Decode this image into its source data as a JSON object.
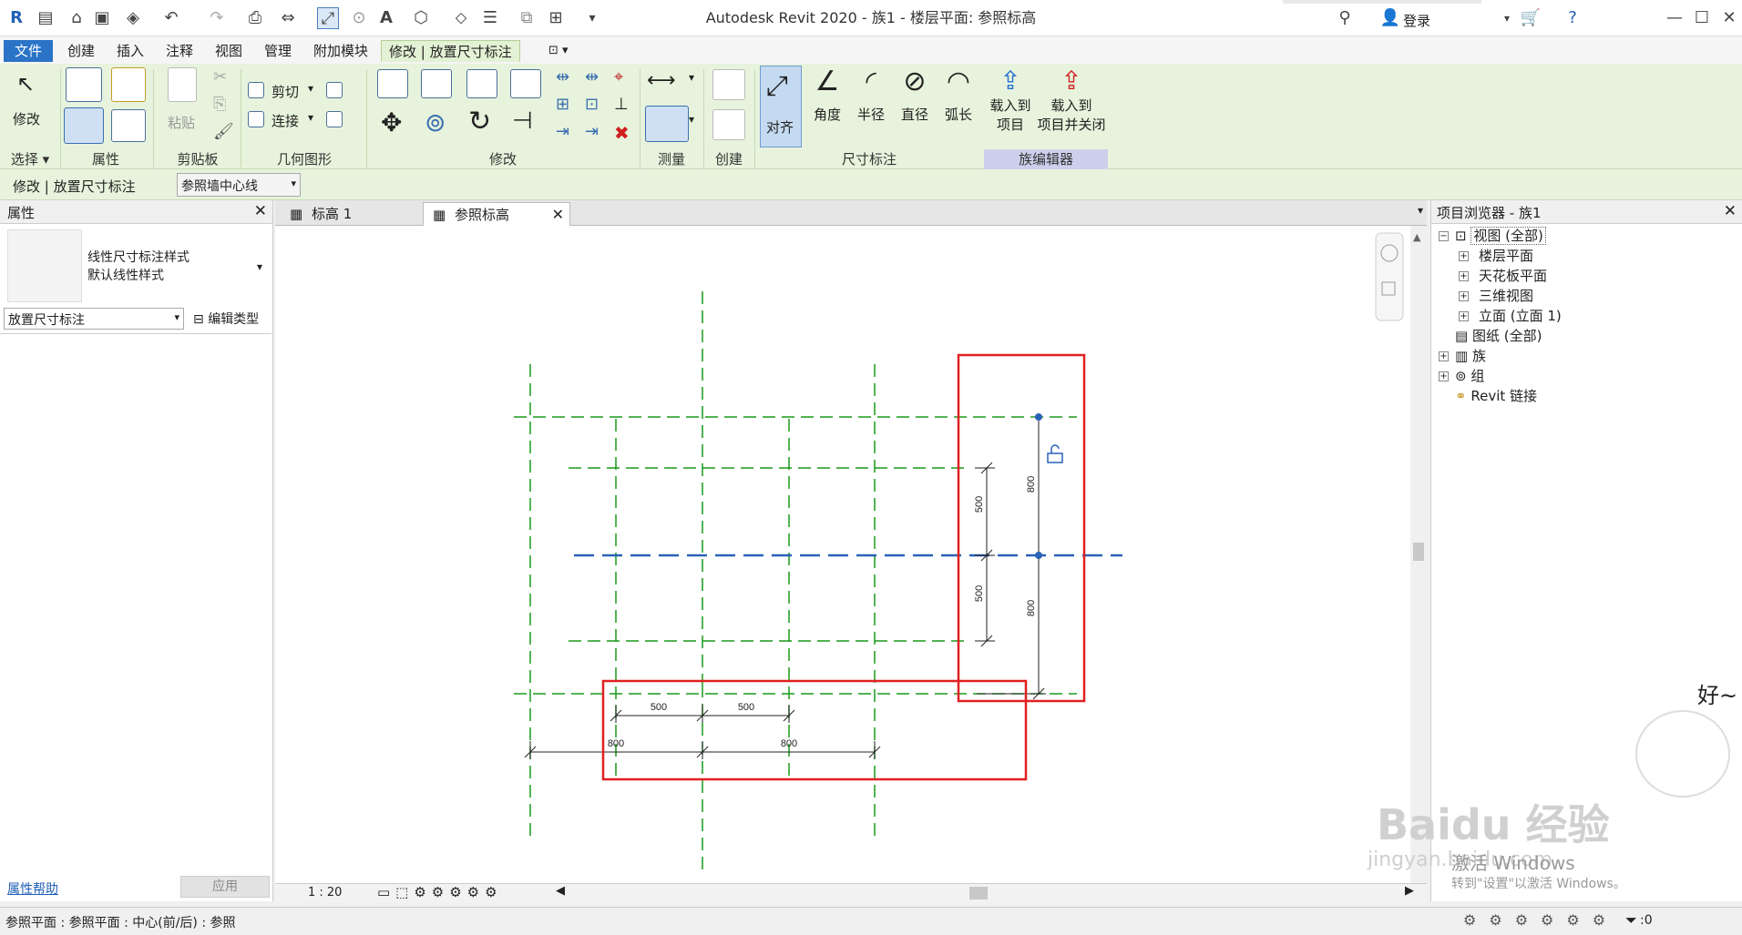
{
  "titlebar": {
    "title": "Autodesk Revit 2020 - 族1 - 楼层平面: 参照标高",
    "login": "登录"
  },
  "ribbon_tabs": {
    "file": "文件",
    "create": "创建",
    "insert": "插入",
    "annotate": "注释",
    "view": "视图",
    "manage": "管理",
    "addins": "附加模块",
    "active": "修改 | 放置尺寸标注"
  },
  "ribbon": {
    "modify": "修改",
    "cut": "剪切",
    "join": "连接",
    "paste": "粘贴",
    "aligned": "对齐",
    "angular": "角度",
    "radial": "半径",
    "diameter": "直径",
    "arc_length": "弧长",
    "load_into_project_1": "载入到",
    "load_into_project_2": "项目",
    "load_close_1": "载入到",
    "load_close_2": "项目并关闭",
    "panels": {
      "select": "选择",
      "properties": "属性",
      "clipboard": "剪贴板",
      "geometry": "几何图形",
      "modify": "修改",
      "measure": "测量",
      "create": "创建",
      "dimension": "尺寸标注",
      "family_editor": "族编辑器"
    }
  },
  "optbar": {
    "context": "修改 | 放置尺寸标注",
    "pick": "参照墙中心线"
  },
  "properties": {
    "title": "属性",
    "type_line1": "线性尺寸标注样式",
    "type_line2": "默认线性样式",
    "selector": "放置尺寸标注",
    "edit_type": "编辑类型",
    "help": "属性帮助",
    "apply": "应用"
  },
  "viewtabs": {
    "tab1": "标高 1",
    "tab2": "参照标高"
  },
  "drawing": {
    "dims": {
      "h500a": "500",
      "h500b": "500",
      "h800a": "800",
      "h800b": "800",
      "v500a": "500",
      "v500b": "500",
      "v800a": "800",
      "v800b": "800"
    }
  },
  "viewctrl": {
    "scale": "1 : 20"
  },
  "browser": {
    "title": "项目浏览器 - 族1",
    "views": "视图 (全部)",
    "floor": "楼层平面",
    "ceiling": "天花板平面",
    "threed": "三维视图",
    "elev": "立面 (立面 1)",
    "sheets": "图纸 (全部)",
    "families": "族",
    "groups": "组",
    "links": "Revit 链接"
  },
  "status": {
    "text": "参照平面 : 参照平面 : 中心(前/后) : 参照",
    "filter_count": ":0"
  },
  "watermark": {
    "activate1": "激活 Windows",
    "activate2": "转到\"设置\"以激活 Windows。",
    "baidu": "Baidu 经验",
    "url": "jingyan.baidu.com",
    "sticker": "好~"
  },
  "colors": {
    "ref_plane": "#1a9a1a",
    "selected_plane": "#2a62b8",
    "highlight": "#e02020",
    "ribbon_green": "#e7f3dc"
  }
}
